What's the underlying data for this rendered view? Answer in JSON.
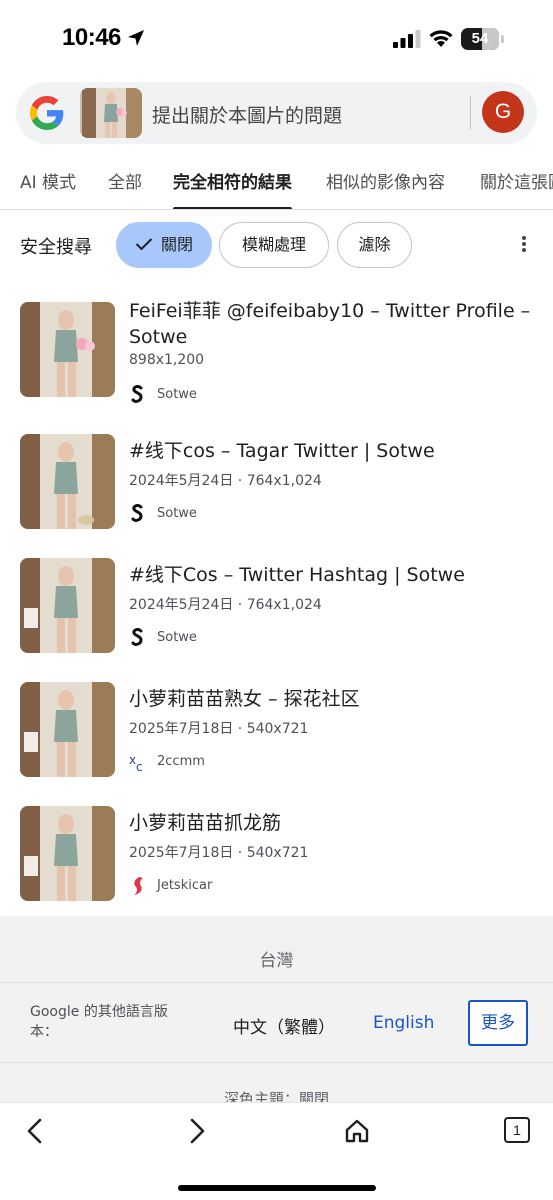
{
  "status_bar": {
    "time": "10:46",
    "battery": "54"
  },
  "search": {
    "query_placeholder": "提出關於本圖片的問題",
    "avatar_letter": "G"
  },
  "tabs": [
    {
      "label": "AI 模式"
    },
    {
      "label": "全部"
    },
    {
      "label": "完全相符的結果"
    },
    {
      "label": "相似的影像內容"
    },
    {
      "label": "關於這張圖"
    }
  ],
  "safe_search": {
    "label": "安全搜尋",
    "chips": [
      {
        "label": "關閉"
      },
      {
        "label": "模糊處理"
      },
      {
        "label": "濾除"
      }
    ]
  },
  "results": [
    {
      "title": "FeiFei菲菲 @feifeibaby10 – Twitter Profile – Sotwe",
      "meta": "898x1,200",
      "source": "Sotwe",
      "source_icon": "sotwe-icon"
    },
    {
      "title": "#线下cos – Tagar Twitter | Sotwe",
      "meta": "2024年5月24日 · 764x1,024",
      "source": "Sotwe",
      "source_icon": "sotwe-icon"
    },
    {
      "title": "#线下Cos – Twitter Hashtag | Sotwe",
      "meta": "2024年5月24日 · 764x1,024",
      "source": "Sotwe",
      "source_icon": "sotwe-icon"
    },
    {
      "title": "小萝莉苗苗熟女 – 探花社区",
      "meta": "2025年7月18日 · 540x721",
      "source": "2ccmm",
      "source_icon": "xc-icon"
    },
    {
      "title": "小萝莉苗苗抓龙筋",
      "meta": "2025年7月18日 · 540x721",
      "source": "Jetskicar",
      "source_icon": "jetskicar-icon"
    }
  ],
  "footer": {
    "region": "台灣",
    "language_label": "Google 的其他語言版本：",
    "languages": [
      "中文（繁體）",
      "English"
    ],
    "more_label": "更多",
    "cut_text": "深色主題：關閉"
  },
  "toolbar": {
    "tabs_count": "1"
  },
  "colors": {
    "accent_blue": "#1a55c8",
    "chip_selected": "#a8c7fa",
    "avatar_bg": "#c4361b"
  }
}
